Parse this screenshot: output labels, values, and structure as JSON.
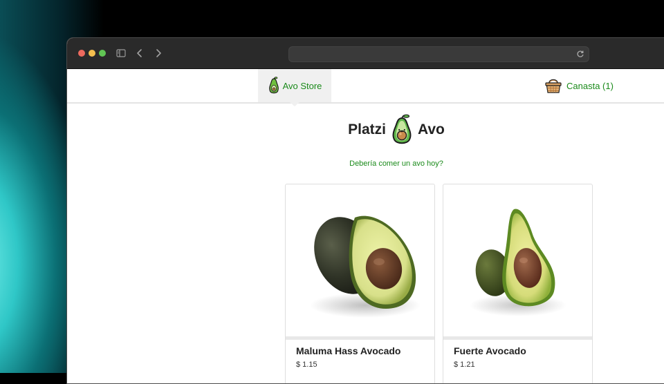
{
  "nav": {
    "home_label": "Avo Store",
    "cart_label": "Canasta (1)"
  },
  "hero": {
    "title_left": "Platzi",
    "title_right": "Avo",
    "tagline": "Debería comer un avo hoy?"
  },
  "products": [
    {
      "name": "Maluma Hass Avocado",
      "price": "$ 1.15"
    },
    {
      "name": "Fuerte Avocado",
      "price": "$ 1.21"
    }
  ],
  "colors": {
    "link_green": "#1a8a1a",
    "titlebar": "#2a2a2a"
  },
  "icons": [
    "sidebar-toggle-icon",
    "back-arrow-icon",
    "forward-arrow-icon",
    "reload-icon",
    "avocado-icon",
    "basket-icon"
  ]
}
